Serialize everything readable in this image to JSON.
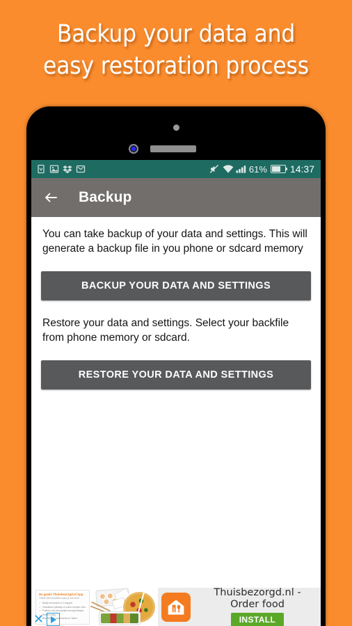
{
  "promo": {
    "headline": "Backup your data and\neasy restoration process",
    "background_color": "#FA8C2E",
    "text_color": "#FFFFFF"
  },
  "phone": {
    "bezel_color": "#000000",
    "screen_background": "#FFFFFF"
  },
  "status_bar": {
    "background_color": "#1E6B62",
    "left_icons": [
      {
        "name": "app-notification-icon",
        "label": ""
      },
      {
        "name": "photo-notification-icon",
        "label": ""
      },
      {
        "name": "dropbox-notification-icon",
        "label": ""
      },
      {
        "name": "gmail-notification-icon",
        "label": ""
      }
    ],
    "right_icons": [
      {
        "name": "mute-icon",
        "label": ""
      },
      {
        "name": "wifi-icon",
        "label": ""
      },
      {
        "name": "signal-bars-icon",
        "label": ""
      }
    ],
    "battery_percent": "61%",
    "battery_level": 61,
    "clock": "14:37"
  },
  "app_bar": {
    "background_color": "#716E6C",
    "back_icon": "back-arrow-icon",
    "title": "Backup"
  },
  "content": {
    "backup_description": "You can take backup of your data and settings. This will generate a backup file in you phone or sdcard memory",
    "backup_button_label": "BACKUP YOUR DATA AND SETTINGS",
    "restore_description": "Restore your data and settings. Select your backfile from phone memory or sdcard.",
    "restore_button_label": "RESTORE YOUR DATA AND SETTINGS",
    "button_color": "#58595B"
  },
  "ad": {
    "title": "Thuisbezorgd.nl - Order food",
    "install_label": "INSTALL",
    "install_color": "#5BA829",
    "app_icon_color": "#F47B20",
    "close_label": "✕",
    "creative": {
      "headline": "De gratis Thuisbezorgd.nl App",
      "subline": "Online eten bestellen waar je ook bent",
      "bullets": [
        "Bekijk het aanbod in 2 stappen",
        "Fantastisch pakketje of online recepten met vlees, PayPal of creditcard",
        "Profiteer van persoonlijke bezorgkortingen",
        "Snel en veilig",
        "Beschikbaar voor Android en Tablet"
      ]
    }
  }
}
